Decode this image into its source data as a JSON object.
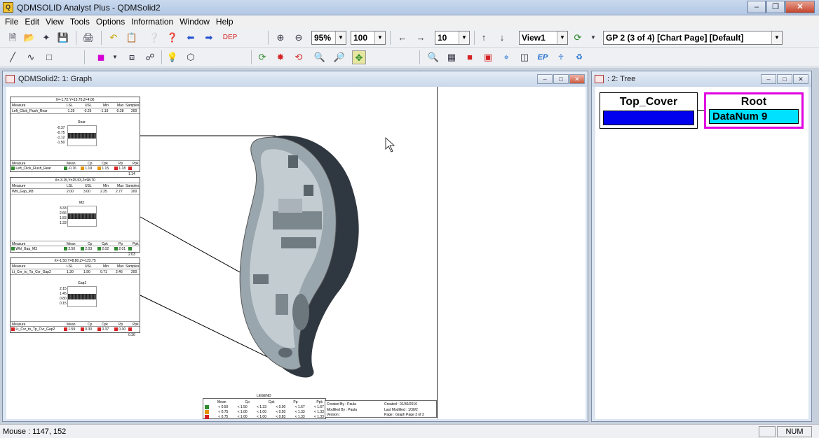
{
  "window": {
    "title": "QDMSOLID Analyst Plus - QDMSolid2",
    "app_icon": "Q"
  },
  "menu": [
    "File",
    "Edit",
    "View",
    "Tools",
    "Options",
    "Information",
    "Window",
    "Help"
  ],
  "toolbar": {
    "dep_label": "DEP",
    "zoom_value": "95%",
    "percent_value": "100",
    "count_value": "10",
    "view_value": "View1",
    "page_value": "GP 2 (3 of 4) [Chart Page] [Default]",
    "ep_label": "EP"
  },
  "graph_window": {
    "title": "QDMSolid2: 1: Graph",
    "features": [
      {
        "coords": "X=-1.72,Y=15.76,Z=4.00",
        "head": [
          "Measure",
          "LSL",
          "USL",
          "Min",
          "Max",
          "Samples"
        ],
        "spec": [
          "Left_Click_Flush_Rear",
          "-1.25",
          "-0.25",
          "-1.19",
          "-0.28",
          "200"
        ],
        "mini_title": "Rear",
        "ticks": [
          "-0.37",
          "-0.75",
          "-1.12",
          "-1.50"
        ],
        "stats_head": [
          "Measure",
          "Mean",
          "Cp",
          "Cpk",
          "Pp",
          "Ppk"
        ],
        "stats": [
          "Left_Click_Flush_Rear",
          "-0.76",
          "1.19",
          "1.15",
          "1.18",
          "1.14"
        ],
        "colors": [
          "#2e8b2e",
          "#2e8b2e",
          "#e69500",
          "#e69500",
          "#d62222",
          "#d62222"
        ]
      },
      {
        "coords": "X=-3.15,Y=25.53,Z=98.70",
        "head": [
          "Measure",
          "LSL",
          "USL",
          "Min",
          "Max",
          "Samples"
        ],
        "spec": [
          "Whl_Gap_M3",
          "2.00",
          "3.00",
          "2.25",
          "2.77",
          "200"
        ],
        "mini_title": "M3",
        "ticks": [
          "3.33",
          "2.66",
          "1.83",
          "1.33"
        ],
        "stats_head": [
          "Measure",
          "Mean",
          "Cp",
          "Cpk",
          "Pp",
          "Ppk"
        ],
        "stats": [
          "Whl_Gap_M3",
          "2.50",
          "2.03",
          "2.02",
          "2.01",
          "2.03"
        ],
        "colors": [
          "#2e8b2e",
          "#2e8b2e",
          "#2e8b2e",
          "#2e8b2e",
          "#2e8b2e",
          "#2e8b2e"
        ]
      },
      {
        "coords": "X=-1.50,Y=8.80,Z=-122.75",
        "head": [
          "Measure",
          "LSL",
          "USL",
          "Min",
          "Max",
          "Samples"
        ],
        "spec": [
          "Lt_Cvr_to_Tp_Cvr_Gap2",
          "1.30",
          "1.90",
          "0.71",
          "2.46",
          "200"
        ],
        "mini_title": "Gap2",
        "ticks": [
          "2.15",
          "1.45",
          "0.80",
          "0.15"
        ],
        "stats_head": [
          "Measure",
          "Mean",
          "Cp",
          "Cpk",
          "Pp",
          "Ppk"
        ],
        "stats": [
          "Lt_Cvr_to_Tp_Cvr_Gap2",
          "1.59",
          "0.30",
          "0.37",
          "0.30",
          "0.30"
        ],
        "colors": [
          "#d62222",
          "#d62222",
          "#d62222",
          "#d62222",
          "#d62222",
          "#d62222"
        ]
      }
    ],
    "legend": {
      "title": "LEGEND",
      "head": [
        "Mean",
        "Cp",
        "Cpk",
        "Pp",
        "Ppk"
      ],
      "rows": [
        {
          "color": "#2e8b2e",
          "cells": [
            "< 0.50",
            "< 1.50",
            "< 1.33",
            "< 0.00",
            "< 1.67",
            "< 1.67"
          ]
        },
        {
          "color": "#e69500",
          "cells": [
            "< 0.75",
            "< 1.00",
            "< 1.00",
            "< 0.50",
            "< 1.33",
            "< 1.33"
          ]
        },
        {
          "color": "#d62222",
          "cells": [
            "< 0.75",
            "< 1.00",
            "< 1.00",
            "< 0.83",
            "< 1.33",
            "< 1.33"
          ]
        }
      ]
    },
    "info": {
      "created_by": "Created By : Paula",
      "modified_by": "Modified By : Paula",
      "version": "Version :",
      "created": "Created : 01/30/2010",
      "last_modified": "Last Modified : 1/30/2",
      "page": "Page : Graph Page 3 of 3"
    }
  },
  "tree_window": {
    "title": ": 2: Tree",
    "nodes": [
      {
        "label": "Top_Cover",
        "value": ""
      },
      {
        "label": "Root",
        "value": "DataNum 9"
      }
    ]
  },
  "status": {
    "mouse": "Mouse : 1147, 152",
    "num": "NUM"
  }
}
